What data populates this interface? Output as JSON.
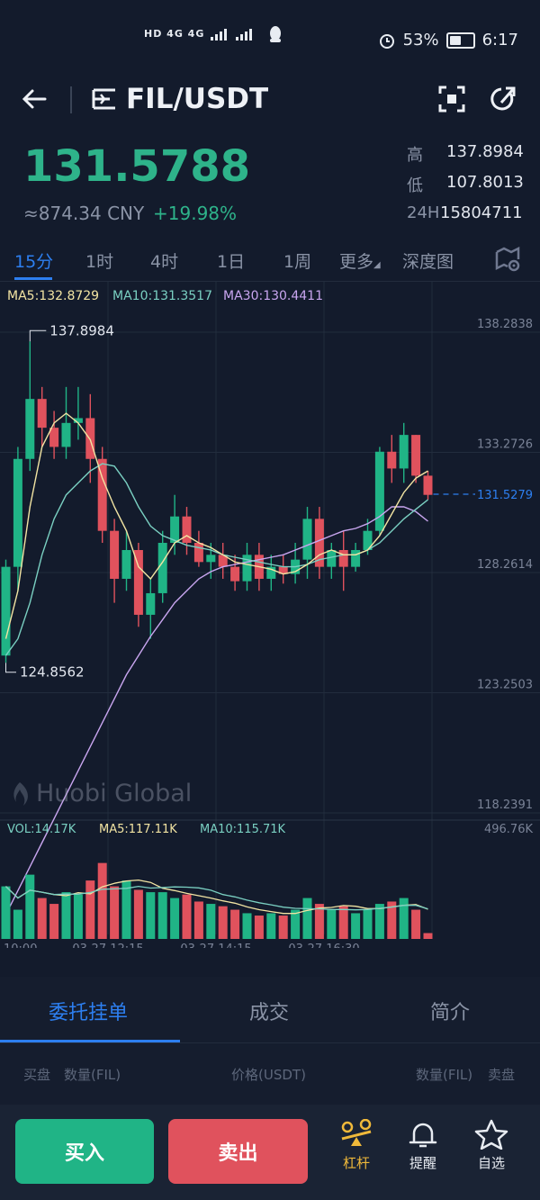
{
  "status_bar": {
    "network": "HD 4G 4G",
    "battery": "53%",
    "battery_level": 0.53,
    "time": "6:17"
  },
  "header": {
    "title": "FIL/USDT"
  },
  "price": {
    "last": "131.5788",
    "cny": "≈874.34 CNY",
    "change": "+19.98%",
    "high_label": "高",
    "high": "137.8984",
    "low_label": "低",
    "low": "107.8013",
    "vol_label": "24H",
    "vol": "15804711"
  },
  "tabs": [
    "15分",
    "1时",
    "4时",
    "1日",
    "1周",
    "更多",
    "深度图"
  ],
  "chart_data": {
    "type": "candlestick",
    "indicators": {
      "ma5": "MA5:132.8729",
      "ma10": "MA10:131.3517",
      "ma30": "MA30:130.4411"
    },
    "y_ticks": [
      "138.2838",
      "133.2726",
      "128.2614",
      "123.2503",
      "118.2391"
    ],
    "y_range": [
      118.2391,
      138.2838
    ],
    "max_label": "137.8984",
    "min_label": "124.8562",
    "current_label": "131.5279",
    "current_value": 131.5279,
    "watermark": "Huobi Global",
    "x_ticks": [
      "10:00",
      "03-27 12:15",
      "03-27 14:15",
      "03-27 16:30"
    ],
    "volume": {
      "vol": "VOL:14.17K",
      "ma5": "MA5:117.11K",
      "ma10": "MA10:115.71K",
      "max": "496.76K"
    },
    "candles": [
      [
        124.8,
        128.5,
        124.5,
        128.8
      ],
      [
        128.5,
        133.0,
        127.5,
        133.5
      ],
      [
        133.0,
        135.5,
        132.5,
        137.9
      ],
      [
        135.5,
        134.3,
        133.5,
        136.0
      ],
      [
        134.3,
        133.5,
        133.0,
        135.0
      ],
      [
        133.5,
        134.5,
        133.0,
        136.0
      ],
      [
        134.5,
        134.7,
        133.8,
        136.0
      ],
      [
        134.7,
        133.0,
        132.0,
        135.7
      ],
      [
        133.0,
        130.0,
        129.5,
        133.5
      ],
      [
        130.0,
        128.0,
        127.0,
        130.5
      ],
      [
        128.0,
        129.2,
        127.5,
        130.0
      ],
      [
        129.2,
        126.5,
        126.0,
        129.5
      ],
      [
        126.5,
        127.4,
        125.5,
        128.0
      ],
      [
        127.4,
        129.5,
        127.0,
        130.0
      ],
      [
        129.5,
        130.6,
        129.0,
        131.5
      ],
      [
        130.6,
        129.5,
        129.0,
        131.0
      ],
      [
        129.5,
        128.7,
        128.5,
        130.0
      ],
      [
        128.7,
        129.0,
        128.0,
        129.5
      ],
      [
        129.0,
        128.5,
        128.0,
        129.5
      ],
      [
        128.5,
        127.9,
        127.5,
        129.0
      ],
      [
        127.9,
        129.0,
        127.5,
        129.5
      ],
      [
        129.0,
        128.0,
        127.5,
        129.5
      ],
      [
        128.0,
        128.5,
        127.5,
        129.0
      ],
      [
        128.5,
        128.2,
        127.8,
        129.0
      ],
      [
        128.2,
        128.8,
        127.8,
        129.5
      ],
      [
        128.8,
        130.5,
        128.0,
        131.0
      ],
      [
        130.5,
        128.5,
        128.0,
        131.0
      ],
      [
        128.5,
        129.2,
        128.0,
        129.5
      ],
      [
        129.2,
        128.5,
        127.5,
        130.0
      ],
      [
        128.5,
        129.2,
        128.3,
        129.5
      ],
      [
        129.2,
        130.0,
        129.0,
        130.5
      ],
      [
        130.0,
        133.3,
        129.8,
        133.5
      ],
      [
        133.3,
        132.6,
        132.0,
        134.0
      ],
      [
        132.6,
        134.0,
        132.0,
        134.5
      ],
      [
        134.0,
        132.3,
        132.0,
        134.0
      ],
      [
        132.3,
        131.5,
        131.3,
        132.5
      ]
    ],
    "volumes": [
      0.45,
      0.25,
      0.55,
      0.35,
      0.3,
      0.4,
      0.38,
      0.5,
      0.65,
      0.45,
      0.5,
      0.42,
      0.4,
      0.4,
      0.35,
      0.38,
      0.32,
      0.3,
      0.28,
      0.25,
      0.22,
      0.2,
      0.22,
      0.2,
      0.25,
      0.35,
      0.3,
      0.25,
      0.28,
      0.22,
      0.25,
      0.3,
      0.32,
      0.35,
      0.25,
      0.05
    ],
    "ma5_line": [
      125.5,
      127.5,
      131.0,
      133.5,
      134.5,
      134.9,
      134.5,
      133.8,
      132.2,
      131.0,
      130.0,
      128.5,
      128.0,
      128.7,
      129.5,
      129.8,
      129.5,
      129.3,
      129.0,
      128.7,
      128.6,
      128.5,
      128.4,
      128.2,
      128.3,
      128.6,
      129.0,
      129.2,
      129.0,
      129.0,
      129.2,
      129.8,
      130.7,
      131.6,
      132.2,
      132.5
    ],
    "ma10_line": [
      124.8,
      125.5,
      127.0,
      129.0,
      130.5,
      131.5,
      132.0,
      132.5,
      132.8,
      132.7,
      132.0,
      131.0,
      130.2,
      129.8,
      129.6,
      129.4,
      129.3,
      129.2,
      129.0,
      128.9,
      128.8,
      128.7,
      128.6,
      128.5,
      128.5,
      128.6,
      128.8,
      128.9,
      129.0,
      129.0,
      129.2,
      129.5,
      130.0,
      130.5,
      130.9,
      131.3
    ],
    "ma30_line": [
      114.0,
      115.0,
      116.0,
      117.0,
      118.0,
      119.0,
      120.0,
      121.0,
      122.0,
      123.0,
      124.0,
      124.8,
      125.6,
      126.3,
      127.0,
      127.5,
      128.0,
      128.3,
      128.5,
      128.6,
      128.7,
      128.8,
      128.9,
      129.0,
      129.2,
      129.4,
      129.6,
      129.8,
      130.0,
      130.1,
      130.3,
      130.6,
      131.0,
      131.0,
      130.8,
      130.4
    ],
    "colors": {
      "up": "#20b486",
      "down": "#e0525d",
      "ma5": "#f2e4a3",
      "ma10": "#7ad0c2",
      "ma30": "#c9a6f0"
    }
  },
  "sheet": {
    "tabs": [
      "委托挂单",
      "成交",
      "简介"
    ],
    "buy_header": "买盘",
    "qty_header_left": "数量(FIL)",
    "price_header": "价格(USDT)",
    "qty_header_right": "数量(FIL)",
    "sell_header": "卖盘"
  },
  "bottom_bar": {
    "buy": "买入",
    "sell": "卖出",
    "leverage": "杠杆",
    "alert": "提醒",
    "watchlist": "自选"
  }
}
